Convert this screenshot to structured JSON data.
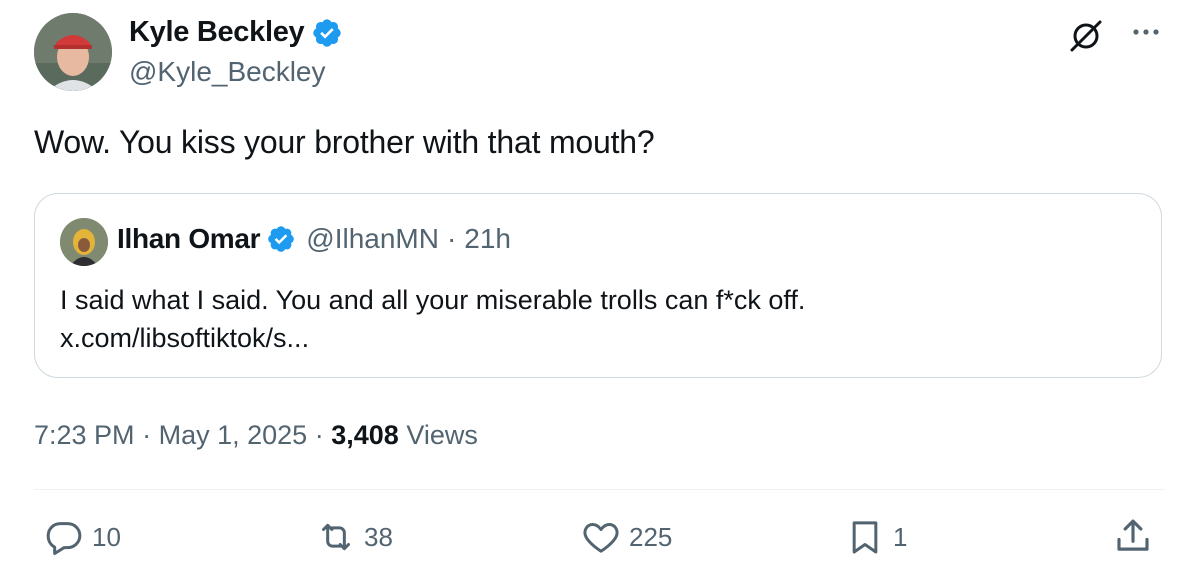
{
  "tweet": {
    "author": {
      "name": "Kyle Beckley",
      "handle": "@Kyle_Beckley"
    },
    "text": "Wow. You kiss your brother with that mouth?",
    "quote": {
      "name": "Ilhan Omar",
      "handle": "@IlhanMN",
      "separator": "·",
      "time": "21h",
      "text_line1": "I said what I said. You and all your miserable trolls can f*ck off.",
      "text_line2": "x.com/libsoftiktok/s..."
    },
    "meta": {
      "time": "7:23 PM",
      "sep1": "·",
      "date": "May 1, 2025",
      "sep2": "·",
      "views_count": "3,408",
      "views_label": "Views"
    },
    "actions": {
      "replies": "10",
      "reposts": "38",
      "likes": "225",
      "bookmarks": "1"
    }
  },
  "icons": {
    "verified": "verified-badge-icon",
    "grok": "grok-icon",
    "more": "more-icon",
    "reply": "reply-icon",
    "repost": "repost-icon",
    "like": "like-icon",
    "bookmark": "bookmark-icon",
    "share": "share-icon"
  },
  "colors": {
    "verified": "#1d9bf0",
    "text": "#0f1419",
    "secondary": "#536471",
    "border": "#cfd9de"
  }
}
